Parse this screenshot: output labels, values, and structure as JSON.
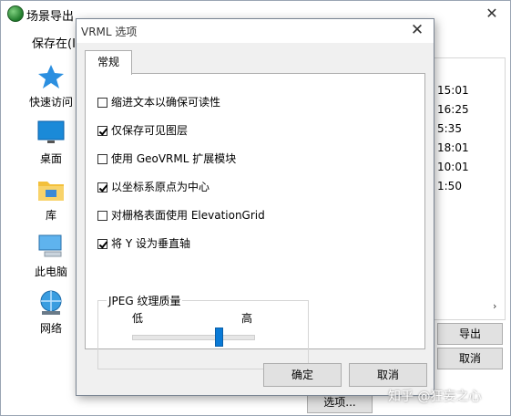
{
  "outer_window": {
    "title": "场景导出",
    "close_glyph": "✕",
    "save_in_label": "保存在(I",
    "places": [
      {
        "label": "快速访问",
        "icon": "star-icon"
      },
      {
        "label": "桌面",
        "icon": "desktop-icon"
      },
      {
        "label": "库",
        "icon": "library-folder-icon"
      },
      {
        "label": "此电脑",
        "icon": "computer-icon"
      },
      {
        "label": "网络",
        "icon": "network-globe-icon"
      }
    ],
    "file_times": [
      "15:01",
      "16:25",
      "5:35",
      "18:01",
      "10:01",
      "1:50"
    ],
    "scroll_glyph": "›",
    "export_button": "导出",
    "cancel_button": "取消",
    "options_button": "选项..."
  },
  "dialog": {
    "title": "VRML 选项",
    "close_glyph": "✕",
    "tab": "常规",
    "options": [
      {
        "label": "缩进文本以确保可读性",
        "checked": false
      },
      {
        "label": "仅保存可见图层",
        "checked": true
      },
      {
        "label": "使用 GeoVRML 扩展模块",
        "checked": false
      },
      {
        "label": "以坐标系原点为中心",
        "checked": true
      },
      {
        "label": "对栅格表面使用 ElevationGrid",
        "checked": false
      },
      {
        "label": "将 Y 设为垂直轴",
        "checked": true
      }
    ],
    "jpeg": {
      "title": "JPEG 纹理质量",
      "low_label": "低",
      "high_label": "高",
      "level": 0.72
    },
    "ok_button": "确定",
    "cancel_button": "取消"
  },
  "watermark": "知乎 @狂妄之心",
  "colors": {
    "accent": "#0a7ad6",
    "background_line": "#d2232a"
  }
}
